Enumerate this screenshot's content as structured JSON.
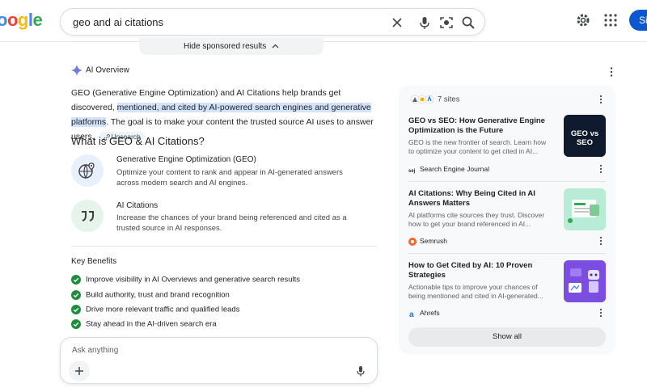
{
  "header": {
    "logo_letters": [
      "o",
      "o",
      "g",
      "l",
      "e"
    ],
    "query": "geo and ai citations",
    "signin_label": "Si"
  },
  "sponsored": {
    "label": "Hide sponsored results"
  },
  "ai_overview": {
    "label": "AI Overview",
    "para_start": "GEO (Generative Engine Optimization) and AI Citations help brands get discovered, ",
    "para_highlight": "mentioned, and cited by AI-powered search engines and generative platforms",
    "para_end": ". The goal is to make your content the trusted source AI uses to answer users.",
    "unsearch": "Unsearch",
    "heading": "What is GEO & AI Citations?",
    "features": [
      {
        "title": "Generative Engine Optimization (GEO)",
        "desc": "Optimize your content to rank and appear in AI-generated answers across modern search and AI engines."
      },
      {
        "title": "AI Citations",
        "desc": "Increase the chances of your brand being referenced and cited as a trusted source in AI responses."
      }
    ],
    "key_benefits_title": "Key Benefits",
    "benefits": [
      "Improve visibility in AI Overviews and generative search results",
      "Build authority, trust and brand recognition",
      "Drive more relevant traffic and qualified leads",
      "Stay ahead in the AI-driven search era"
    ]
  },
  "ask": {
    "placeholder": "Ask anything"
  },
  "sources": {
    "count_label": "7 sites",
    "cards": [
      {
        "title": "GEO vs SEO: How Generative Engine Optimization is the Future",
        "desc": "GEO is the new frontier of search. Learn how to optimize your content to get cited in AI...",
        "source": "Search Engine Journal",
        "thumb_text": "GEO vs SEO"
      },
      {
        "title": "AI Citations: Why Being Cited in AI Answers Matters",
        "desc": "AI platforms cite sources they trust. Discover how to get your brand referenced in AI...",
        "source": "Semrush"
      },
      {
        "title": "How to Get Cited by AI: 10 Proven Strategies",
        "desc": "Actionable tips to improve your chances of being mentioned and cited in AI-generated...",
        "source": "Ahrefs"
      }
    ],
    "show_all": "Show all"
  },
  "colors": {
    "accent": "#0b57d0",
    "highlight": "#d3e3fd",
    "check": "#1e8e3e"
  }
}
